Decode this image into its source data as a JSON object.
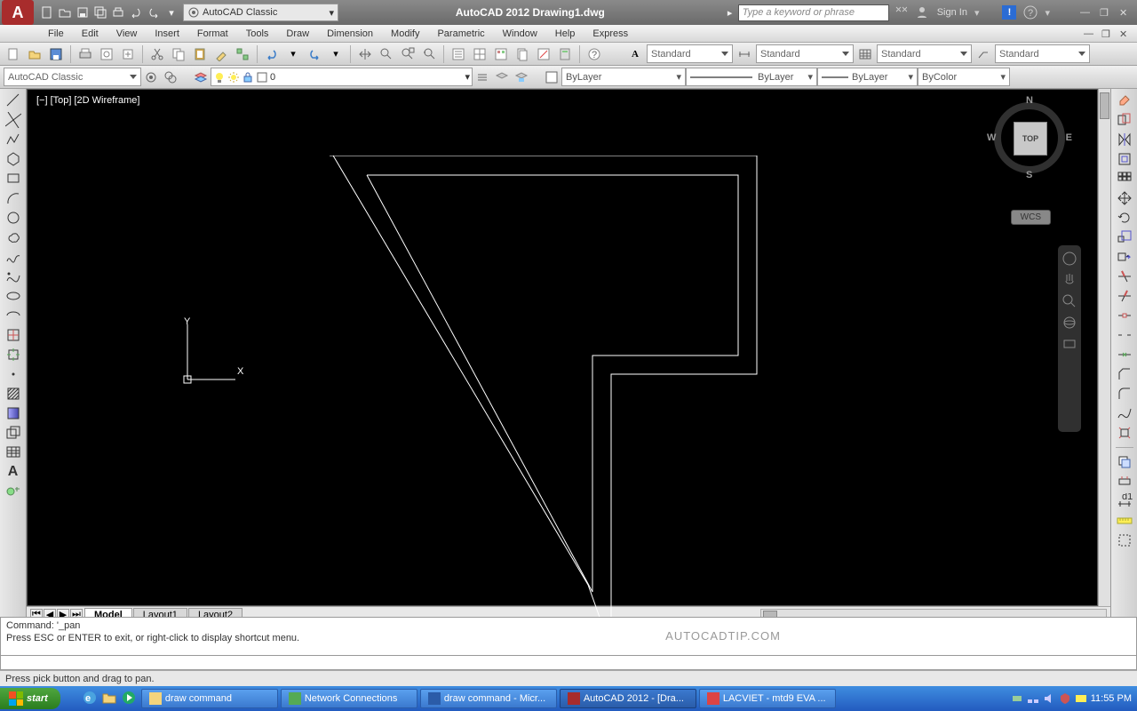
{
  "app": {
    "title": "AutoCAD 2012   Drawing1.dwg",
    "workspace_dropdown": "AutoCAD Classic",
    "search_placeholder": "Type a keyword or phrase",
    "signin": "Sign In"
  },
  "menus": [
    "File",
    "Edit",
    "View",
    "Insert",
    "Format",
    "Tools",
    "Draw",
    "Dimension",
    "Modify",
    "Parametric",
    "Window",
    "Help",
    "Express"
  ],
  "toolbar_styles": {
    "text_style": "Standard",
    "dim_style": "Standard",
    "table_style": "Standard",
    "ml_style": "Standard"
  },
  "layer_row": {
    "workspace": "AutoCAD Classic",
    "layer_name": "0",
    "prop_layer1": "ByLayer",
    "prop_layer2": "ByLayer",
    "prop_layer3": "ByLayer",
    "prop_color": "ByColor"
  },
  "viewport": {
    "label": "[−] [Top] [2D Wireframe]",
    "cube_face": "TOP",
    "wcs": "WCS",
    "dir_n": "N",
    "dir_s": "S",
    "dir_e": "E",
    "dir_w": "W",
    "ucs_y": "Y",
    "ucs_x": "X"
  },
  "tabs": {
    "model": "Model",
    "layout1": "Layout1",
    "layout2": "Layout2"
  },
  "command": {
    "line1": "Command: '_pan",
    "line2": "Press ESC or ENTER to exit, or right-click to display shortcut menu.",
    "watermark": "AUTOCADTIP.COM"
  },
  "status": {
    "hint": "Press pick button and drag to pan."
  },
  "taskbar": {
    "start": "start",
    "items": [
      "draw command",
      "Network Connections",
      "draw command - Micr...",
      "AutoCAD 2012 - [Dra...",
      "LACVIET - mtd9 EVA ..."
    ],
    "time": "11:55 PM"
  }
}
